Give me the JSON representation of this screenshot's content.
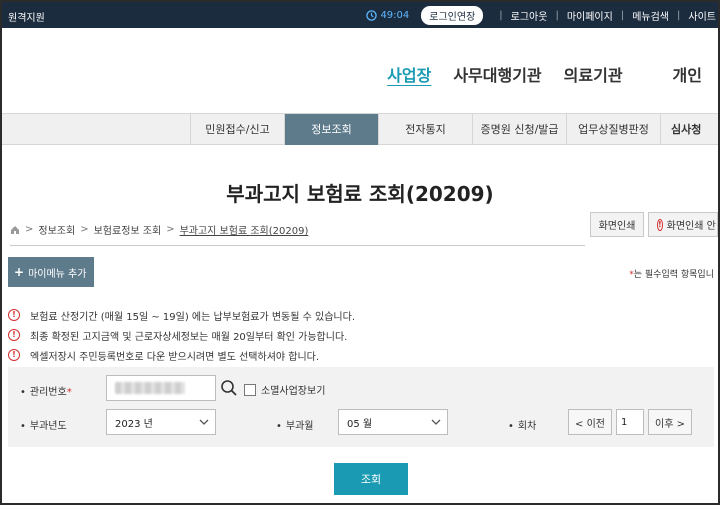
{
  "topbar": {
    "left_text": "원격지원",
    "timer": "49:04",
    "extend_label": "로그인연장",
    "links": [
      "로그아웃",
      "마이페이지",
      "메뉴검색",
      "사이트"
    ]
  },
  "user_tabs": [
    "사업장",
    "사무대행기관",
    "의료기관",
    "개인"
  ],
  "menu": [
    "민원접수/신고",
    "정보조회",
    "전자통지",
    "증명원 신청/발급",
    "업무상질병판정",
    "심사청"
  ],
  "page_title": "부과고지 보험료 조회(20209)",
  "breadcrumb": [
    "정보조회",
    "보험료정보 조회",
    "부과고지 보험료 조회(20209)"
  ],
  "buttons": {
    "print": "화면인쇄",
    "print_pop": "화면인쇄 안",
    "my_menu": "마이메뉴 추가",
    "search": "조회",
    "prev": "< 이전",
    "next": "이후 >"
  },
  "required_note": {
    "star": "*",
    "text": "는 필수입력 항목입니"
  },
  "notices": [
    "보험료 산정기간 (매월 15일 ~ 19일) 에는 납부보험료가 변동될 수 있습니다.",
    "최종 확정된 고지금액 및 근로자상세정보는 매월 20일부터 확인 가능합니다.",
    "엑셀저장시 주민등록번호로 다운 받으시려면 별도 선택하셔야 합니다."
  ],
  "form": {
    "mgmt_label": "관리번호",
    "mgmt_star": "*",
    "subsidiary_label": "소멸사업장보기",
    "year_label": "부과년도",
    "year_value": "2023 년",
    "month_label": "부과월",
    "month_value": "05 월",
    "round_label": "회차",
    "round_value": "1"
  },
  "colors": {
    "topbar": "#1c2c3f",
    "accent": "#1a9bb3",
    "menu_active": "#5e7b8c",
    "warning": "#d32f2f"
  }
}
